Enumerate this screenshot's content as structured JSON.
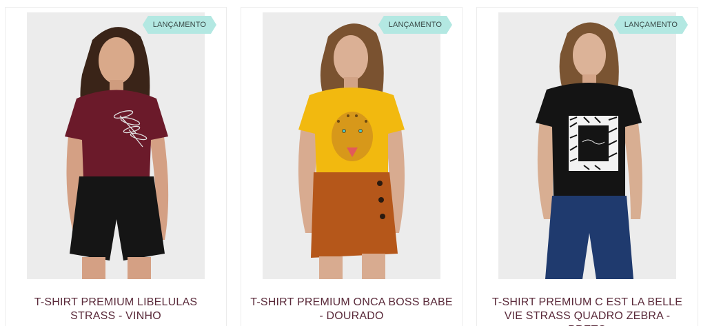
{
  "colors": {
    "badge_bg": "#b3e8e2",
    "title_text": "#5a2a3a"
  },
  "products": [
    {
      "badge": "LANÇAMENTO",
      "name": "T-SHIRT PREMIUM LIBELULAS STRASS - VINHO",
      "shirt_color": "#6b1a2a",
      "bottom_color": "#151515",
      "print": "dragonfly"
    },
    {
      "badge": "LANÇAMENTO",
      "name": "T-SHIRT PREMIUM ONCA BOSS BABE - DOURADO",
      "shirt_color": "#f2b90f",
      "bottom_color": "#b5571a",
      "print": "leopard"
    },
    {
      "badge": "LANÇAMENTO",
      "name": "T-SHIRT PREMIUM C EST LA BELLE VIE STRASS QUADRO ZEBRA - PRETO",
      "shirt_color": "#141414",
      "bottom_color": "#1f3a6e",
      "print": "zebra-frame"
    }
  ]
}
